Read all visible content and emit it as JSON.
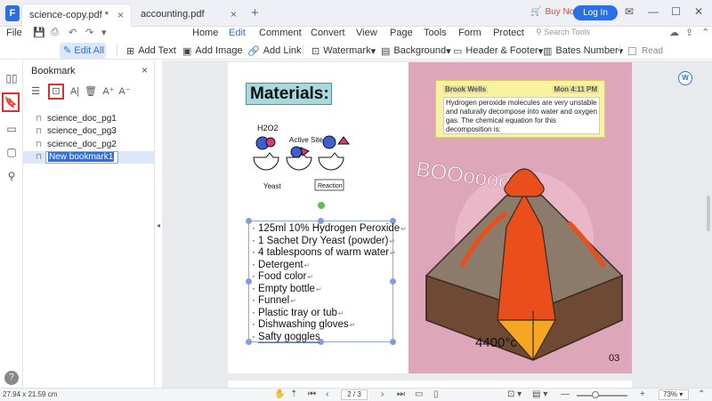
{
  "tabs": [
    {
      "label": "science-copy.pdf *",
      "active": true
    },
    {
      "label": "accounting.pdf",
      "active": false
    }
  ],
  "header": {
    "buy_now": "Buy Now",
    "login": "Log In"
  },
  "menu": {
    "file": "File",
    "items": [
      "Home",
      "Edit",
      "Comment",
      "Convert",
      "View",
      "Page",
      "Tools",
      "Form",
      "Protect"
    ],
    "active": "Edit",
    "search_placeholder": "Search Tools"
  },
  "toolbar": {
    "edit_all": "Edit All",
    "add_text": "Add Text",
    "add_image": "Add Image",
    "add_link": "Add Link",
    "watermark": "Watermark",
    "background": "Background",
    "header_footer": "Header & Footer",
    "bates_number": "Bates Number",
    "read": "Read"
  },
  "bookmark_panel": {
    "title": "Bookmark",
    "items": [
      "science_doc_pg1",
      "science_doc_pg3",
      "science_doc_pg2"
    ],
    "editing_value": "New bookmark1"
  },
  "document": {
    "materials_title": "Materials:",
    "materials": [
      "125ml 10% Hydrogen Peroxide",
      "1 Sachet Dry Yeast (powder)",
      "4 tablespoons of warm water",
      "Detergent",
      "Food color",
      "Empty bottle",
      "Funnel",
      "Plastic tray or tub",
      "Dishwashing gloves",
      "Safty goggles"
    ],
    "diagram_labels": {
      "h2o2": "H2O2",
      "active_site": "Active Site",
      "yeast": "Yeast",
      "reaction": "Reaction"
    },
    "sticky_note": {
      "author": "Brook Wells",
      "time": "Mon 4:11 PM",
      "text": "Hydrogen peroxide molecules are very unstable and naturally decompose into water and oxygen gas. The chemical equation for this decomposition is:"
    },
    "volcano_text": "BOOoooom!",
    "temperature": "4400°c",
    "page_number": "03"
  },
  "statusbar": {
    "page_size": "27.94 x 21.59 cm",
    "page_indicator": "2 / 3",
    "zoom": "73%"
  },
  "colors": {
    "accent": "#2b6fe6",
    "highlight_red": "#d93030",
    "page_pink": "#dea6b9",
    "sticky_yellow": "#f9f2a1",
    "title_teal": "#a9d8de"
  }
}
